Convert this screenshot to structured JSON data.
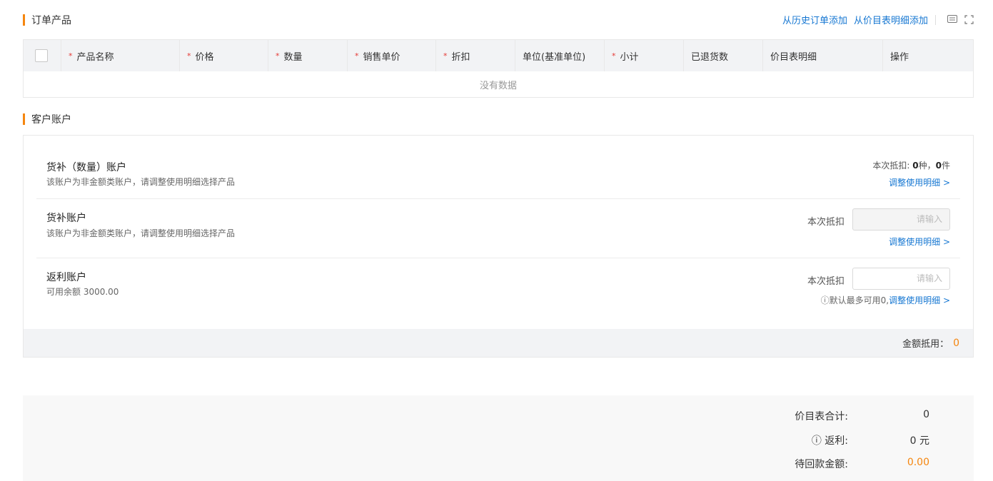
{
  "order_section": {
    "title": "订单产品"
  },
  "top_actions": {
    "add_from_history": "从历史订单添加",
    "add_from_price_list": "从价目表明细添加",
    "settings_icon": "table-settings-icon",
    "fullscreen_icon": "fullscreen-icon"
  },
  "table": {
    "columns": [
      {
        "label": "产品名称",
        "required": true
      },
      {
        "label": "价格",
        "required": true
      },
      {
        "label": "数量",
        "required": true
      },
      {
        "label": "销售单价",
        "required": true
      },
      {
        "label": "折扣",
        "required": true
      },
      {
        "label": "单位(基准单位)",
        "required": false
      },
      {
        "label": "小计",
        "required": true
      },
      {
        "label": "已退货数",
        "required": false
      },
      {
        "label": "价目表明细",
        "required": false
      },
      {
        "label": "操作",
        "required": false
      }
    ],
    "empty_text": "没有数据"
  },
  "account_section": {
    "title": "客户账户"
  },
  "accounts": {
    "goods_qty": {
      "name": "货补（数量）账户",
      "desc": "该账户为非金额类账户，请调整使用明细选择产品",
      "deduct_label": "本次抵扣:",
      "kinds": "0",
      "kinds_unit": "种，",
      "pieces": "0",
      "pieces_unit": "件",
      "adjust_link": "调整使用明细 >"
    },
    "goods": {
      "name": "货补账户",
      "desc": "该账户为非金额类账户，请调整使用明细选择产品",
      "deduct_label": "本次抵扣",
      "placeholder": "请输入",
      "adjust_link": "调整使用明细 >"
    },
    "rebate": {
      "name": "返利账户",
      "desc": "可用余额 3000.00",
      "deduct_label": "本次抵扣",
      "placeholder": "请输入",
      "hint_prefix": "ⓘ默认最多可用0,",
      "adjust_link": "调整使用明细 >"
    },
    "footer": {
      "label": "金额抵用：",
      "value": "0"
    }
  },
  "summary": {
    "price_total_label": "价目表合计:",
    "price_total_value": "0",
    "rebate_label": "ⓘ 返利:",
    "rebate_value": "0 元",
    "pending_label": "待回款金额:",
    "pending_value": "0.00"
  },
  "colors": {
    "accent": "#f5860f",
    "link": "#1677d2"
  }
}
